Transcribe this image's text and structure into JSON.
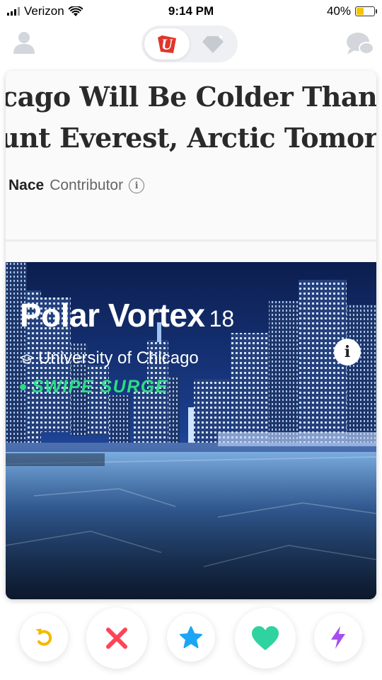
{
  "status_bar": {
    "carrier": "Verizon",
    "time": "9:14 PM",
    "battery": "40%",
    "battery_level": 0.4
  },
  "top_nav": {
    "logo_letter": "U"
  },
  "card": {
    "article": {
      "headline_line1": "cago Will Be Colder Than",
      "headline_line2": "unt Everest, Arctic Tomorro",
      "author": "Nace",
      "role": "Contributor"
    },
    "profile": {
      "name": "Polar Vortex",
      "age": "18",
      "school": "University of Chicago",
      "badge": "SWIPE SURGE"
    }
  },
  "colors": {
    "rewind": "#f5b800",
    "nope": "#ff4458",
    "super_like": "#1aa6f5",
    "like": "#2fd3a0",
    "boost": "#a54ef0",
    "surge": "#2ddc86"
  },
  "actions": [
    {
      "icon": "rewind-icon"
    },
    {
      "icon": "nope-icon"
    },
    {
      "icon": "super-like-icon"
    },
    {
      "icon": "like-icon"
    },
    {
      "icon": "boost-icon"
    }
  ]
}
